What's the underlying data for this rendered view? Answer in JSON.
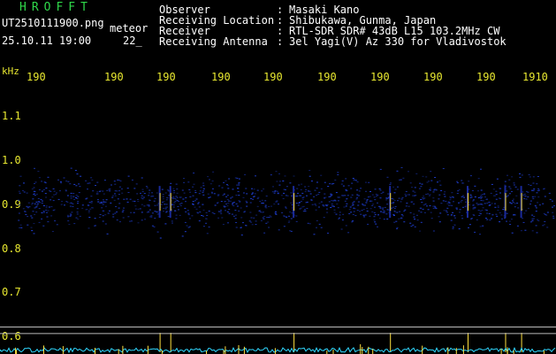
{
  "header": {
    "logo": "HROFFT",
    "filename": "UT2510111900.png",
    "tag": "meteor",
    "datetime": "25.10.11 19:00",
    "count": "22_",
    "fields": [
      {
        "label": "Observer",
        "sep": ":",
        "value": "Masaki Kano"
      },
      {
        "label": "Receiving Location",
        "sep": ":",
        "value": "Shibukawa, Gunma, Japan"
      },
      {
        "label": "Receiver",
        "sep": ":",
        "value": "RTL-SDR SDR# 43dB L15 103.2MHz CW"
      },
      {
        "label": "Receiving Antenna",
        "sep": ":",
        "value": "3el Yagi(V) Az 330 for Vladivostok"
      }
    ]
  },
  "spectrogram": {
    "y_unit": "kHz",
    "y_ticks": [
      "1.1",
      "1.0",
      "0.9",
      "0.8",
      "0.7",
      "0.6"
    ],
    "y_values": [
      1.1,
      1.0,
      0.9,
      0.8,
      0.7,
      0.6
    ],
    "y_range": [
      0.58,
      1.16
    ],
    "x_ticks": [
      "190",
      "190",
      "190",
      "190",
      "190",
      "190",
      "190",
      "190",
      "190",
      "1910"
    ],
    "band_center_khz": 0.905,
    "band_halfwidth_khz": 0.09,
    "colors": {
      "background": "#000000",
      "text": "#ffffff",
      "ticks": "#e8e830",
      "logo": "#2fd84a",
      "noise": "#1a2a9a",
      "echo": "#ffe040",
      "baseline": "#30d8ff",
      "guide_line": "#bbbbbb"
    },
    "echo_times": [
      0.265,
      0.285,
      0.515,
      0.695,
      0.84,
      0.91,
      0.94
    ],
    "guide_lines_khz": [
      0.62,
      0.605
    ]
  }
}
